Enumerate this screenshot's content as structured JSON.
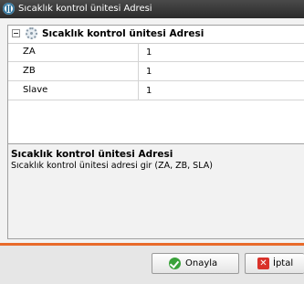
{
  "window": {
    "title": "Sıcaklık kontrol ünitesi Adresi"
  },
  "grid": {
    "title": "Sıcaklık kontrol ünitesi Adresi",
    "rows": [
      {
        "label": "ZA",
        "value": "1"
      },
      {
        "label": "ZB",
        "value": "1"
      },
      {
        "label": "Slave",
        "value": "1"
      }
    ]
  },
  "description": {
    "title": "Sıcaklık kontrol ünitesi Adresi",
    "text": "Sıcaklık kontrol ünitesi adresi gir (ZA, ZB, SLA)"
  },
  "buttons": {
    "ok_label": "Onayla",
    "cancel_label": "İptal"
  },
  "colors": {
    "accent": "#e86a2a",
    "titlebar": "#333333",
    "ok_icon": "#3aa23a",
    "cancel_icon": "#d9322a"
  },
  "icons": [
    "app-icon",
    "collapse-icon",
    "gear-icon",
    "check-icon",
    "x-icon"
  ]
}
